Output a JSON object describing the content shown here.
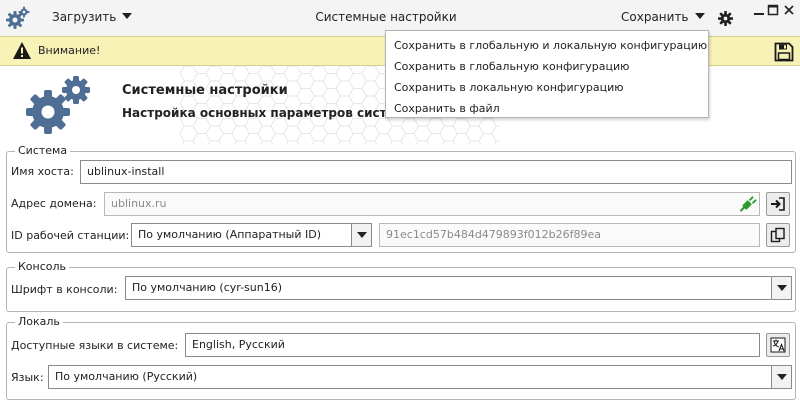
{
  "window": {
    "title": "Системные настройки",
    "load_menu": "Загрузить",
    "save_menu": "Сохранить"
  },
  "warning": {
    "text": "Внимание!"
  },
  "header": {
    "title": "Системные настройки",
    "subtitle": "Настройка основных параметров системы"
  },
  "save_dropdown": {
    "items": [
      "Сохранить в глобальную и локальную конфигурацию",
      "Сохранить в глобальную конфигурацию",
      "Сохранить в локальную конфигурацию",
      "Сохранить в файл"
    ]
  },
  "system": {
    "legend": "Система",
    "hostname_label": "Имя хоста:",
    "hostname_value": "ublinux-install",
    "domain_label": "Адрес домена:",
    "domain_value": "ublinux.ru",
    "station_label": "ID рабочей станции:",
    "station_mode": "По умолчанию (Аппаратный ID)",
    "station_id": "91ec1cd57b484d479893f012b26f89ea"
  },
  "console": {
    "legend": "Консоль",
    "font_label": "Шрифт в консоли:",
    "font_value": "По умолчанию (cyr-sun16)"
  },
  "locale": {
    "legend": "Локаль",
    "langs_label": "Доступные языки в системе:",
    "langs_value": "English, Русский",
    "lang_label": "Язык:",
    "lang_value": "По умолчанию (Русский)"
  },
  "colors": {
    "accent": "#4e6e96",
    "warning_bg": "#f7f2b6",
    "plug_green": "#2e9a2e"
  },
  "icons": {
    "app": "gears-icon",
    "settings": "gear-icon",
    "warning": "warning-triangle-icon",
    "save_disk": "floppy-disk-icon",
    "domain_join": "plug-icon",
    "domain_login": "login-arrow-icon",
    "copy": "copy-icon",
    "languages": "translate-icon"
  }
}
